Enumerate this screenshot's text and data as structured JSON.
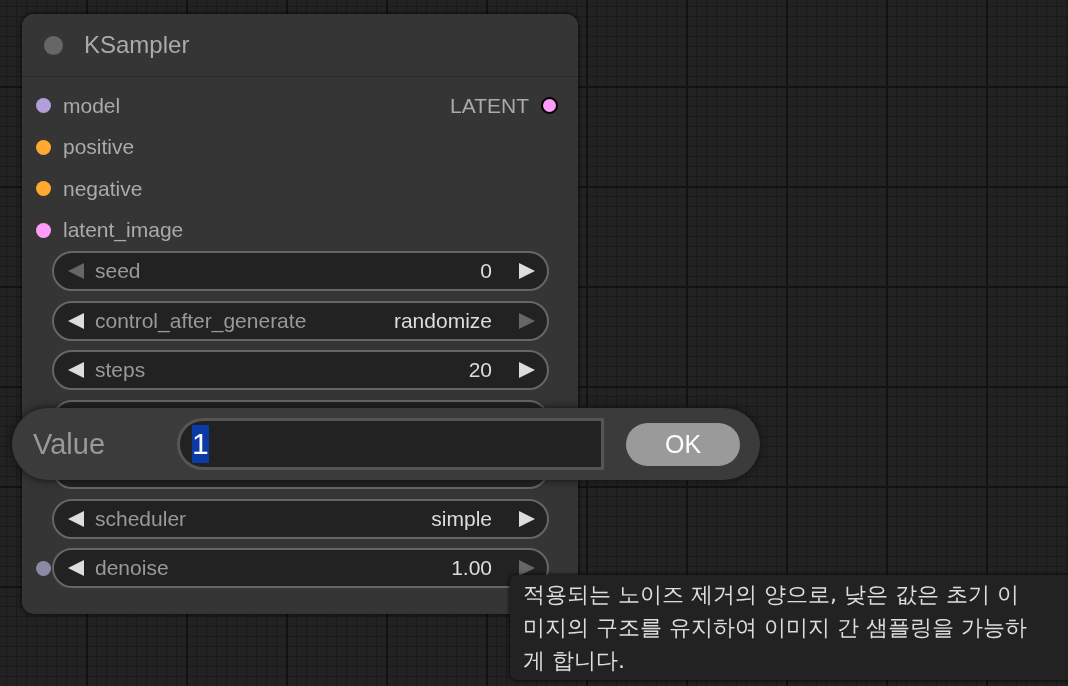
{
  "node": {
    "title": "KSampler",
    "inputs": [
      {
        "name": "model",
        "color": "#b39ddb"
      },
      {
        "name": "positive",
        "color": "#ffa931"
      },
      {
        "name": "negative",
        "color": "#ffa931"
      },
      {
        "name": "latent_image",
        "color": "#ff9cf9"
      }
    ],
    "outputs": [
      {
        "name": "LATENT",
        "color": "#ff9cf9"
      }
    ],
    "widgets": [
      {
        "kind": "widget",
        "label": "seed",
        "value": "0",
        "can_decrease": false,
        "can_increase": true
      },
      {
        "kind": "widget",
        "label": "control_after_generate",
        "value": "randomize",
        "can_decrease": true,
        "can_increase": false
      },
      {
        "kind": "widget",
        "label": "steps",
        "value": "20",
        "can_decrease": true,
        "can_increase": true
      },
      {
        "kind": "covered"
      },
      {
        "kind": "covered"
      },
      {
        "kind": "widget",
        "label": "scheduler",
        "value": "simple",
        "can_decrease": true,
        "can_increase": true
      },
      {
        "kind": "widget",
        "label": "denoise",
        "value": "1.00",
        "can_decrease": true,
        "can_increase": false,
        "input": {
          "color": "#8a8aa6"
        }
      }
    ]
  },
  "dialog": {
    "label": "Value",
    "value": "1",
    "button": "OK"
  },
  "tooltip": "적용되는 노이즈 제거의 양으로, 낮은 값은 초기 이미지의 구조를 유지하여 이미지 간 샘플링을 가능하게 합니다."
}
